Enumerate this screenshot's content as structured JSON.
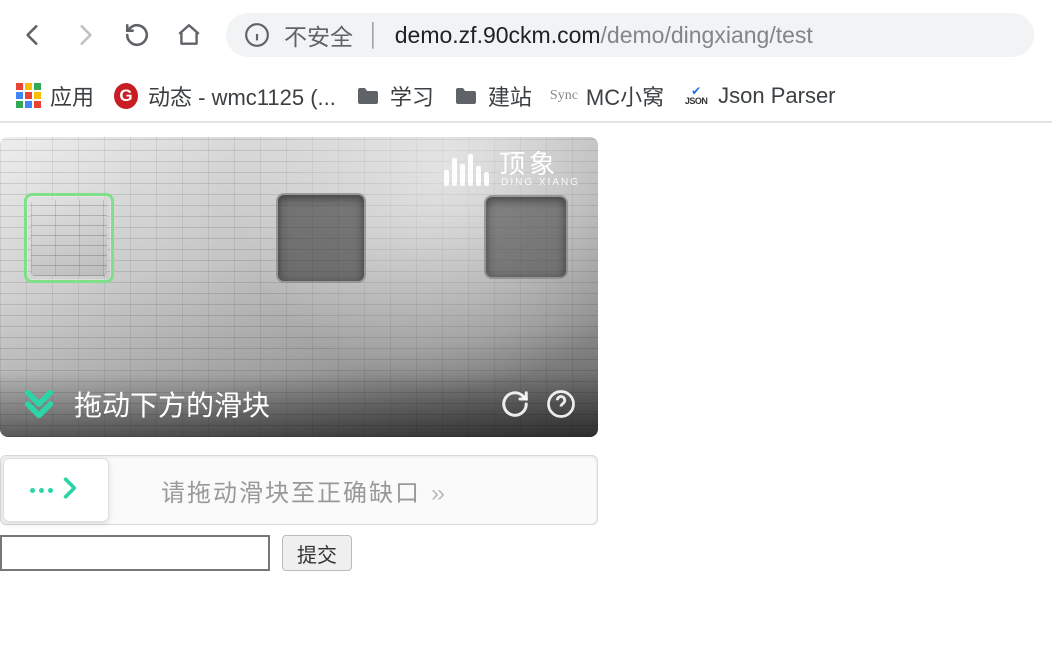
{
  "browser": {
    "url_insecure_label": "不安全",
    "url_host": "demo.zf.90ckm.com",
    "url_path": "/demo/dingxiang/test"
  },
  "bookmarks": {
    "apps": "应用",
    "gitee": "动态 - wmc1125 (...",
    "study": "学习",
    "site": "建站",
    "mc": "MC小窝",
    "json": "Json Parser"
  },
  "captcha": {
    "brand_cn": "顶象",
    "brand_en": "DING XIANG",
    "hint": "拖动下方的滑块",
    "slider_placeholder": "请拖动滑块至正确缺口",
    "slider_chev": "››"
  },
  "form": {
    "input_value": "",
    "submit_label": "提交"
  }
}
